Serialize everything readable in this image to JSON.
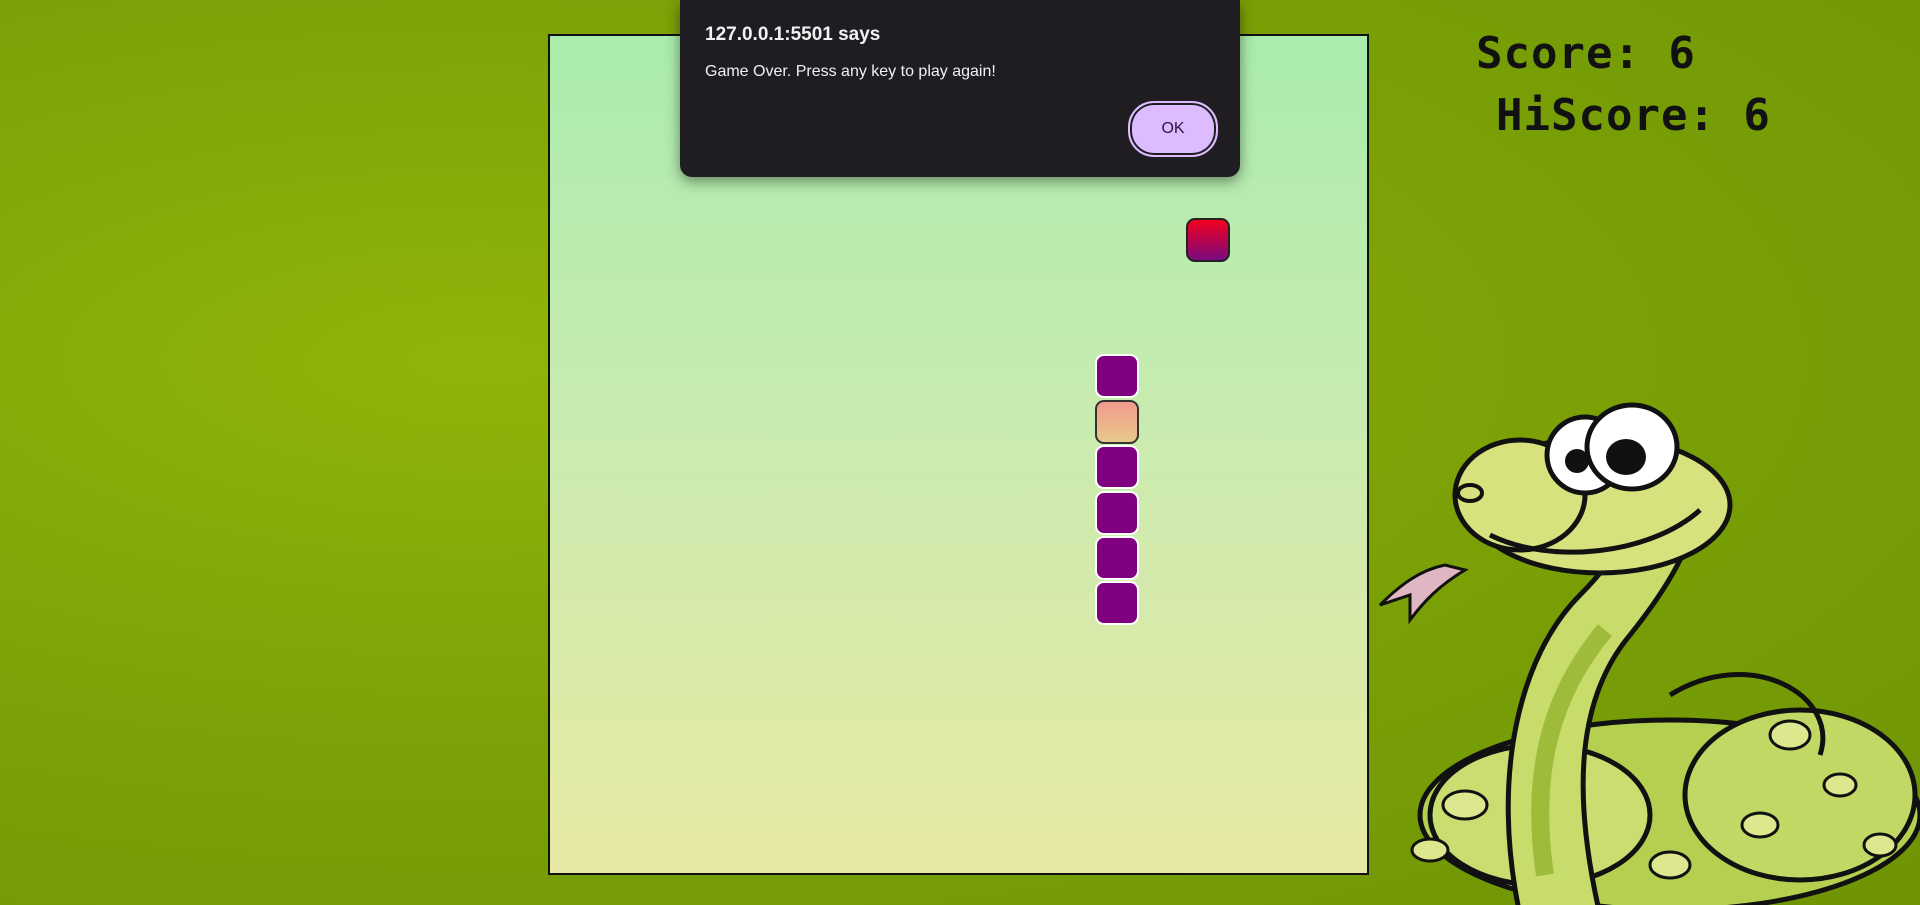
{
  "dialog": {
    "title": "127.0.0.1:5501 says",
    "message": "Game Over. Press any key to play again!",
    "ok_label": "OK"
  },
  "scoreboard": {
    "score_text": "Score: 6",
    "hiscore_text": "HiScore: 6"
  },
  "game": {
    "grid_size": 18,
    "snake": [
      {
        "x": 13,
        "y": 8,
        "part": "body"
      },
      {
        "x": 13,
        "y": 9,
        "part": "head"
      },
      {
        "x": 13,
        "y": 10,
        "part": "body"
      },
      {
        "x": 13,
        "y": 11,
        "part": "body"
      },
      {
        "x": 13,
        "y": 12,
        "part": "body"
      },
      {
        "x": 13,
        "y": 13,
        "part": "body"
      }
    ],
    "food": {
      "x": 15,
      "y": 5
    }
  },
  "colors": {
    "snake_body": "#800080",
    "dialog_accent": "#dcbcff",
    "background": "#7da307"
  },
  "icons": {
    "mascot": "cartoon-snake-icon"
  }
}
